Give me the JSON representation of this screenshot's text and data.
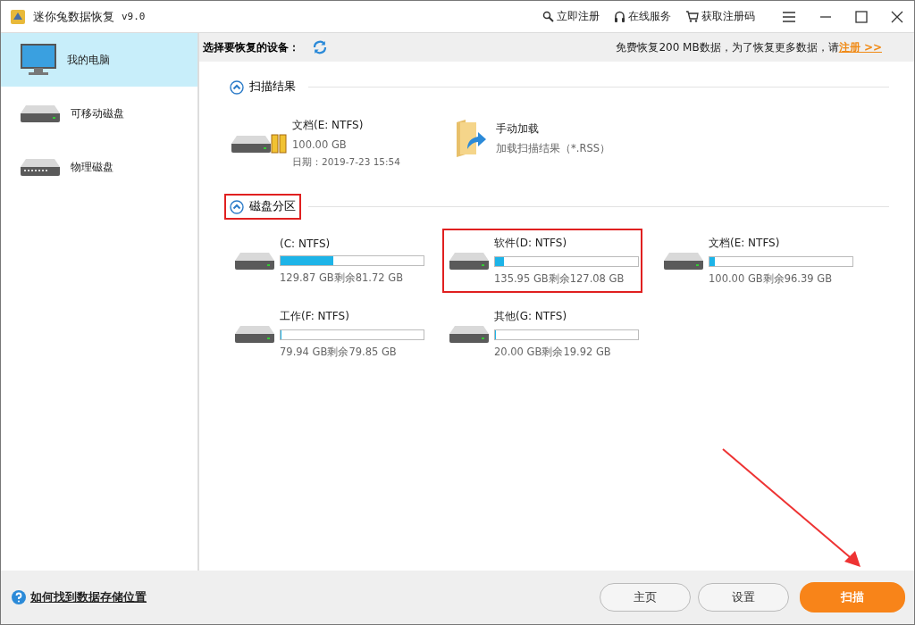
{
  "window": {
    "title": "迷你兔数据恢复",
    "version": "v9.0"
  },
  "title_links": [
    {
      "kind": "register",
      "label": "立即注册"
    },
    {
      "kind": "service",
      "label": "在线服务"
    },
    {
      "kind": "cart",
      "label": "获取注册码"
    }
  ],
  "sidebar": {
    "items": [
      {
        "kind": "computer",
        "label": "我的电脑",
        "selected": true
      },
      {
        "kind": "removable",
        "label": "可移动磁盘",
        "selected": false
      },
      {
        "kind": "physical",
        "label": "物理磁盘",
        "selected": false
      }
    ]
  },
  "toolbar": {
    "label": "选择要恢复的设备：",
    "promo": "免费恢复200 MB数据，为了恢复更多数据，请",
    "promo_link": "注册 >>"
  },
  "scan_results": {
    "title": "扫描结果",
    "expanded": true,
    "highlighted": false,
    "result": {
      "name": "文档(E: NTFS)",
      "size": "100.00 GB",
      "date": "日期：2019-7-23 15:54"
    },
    "manual_load": {
      "title": "手动加载",
      "subtitle": "加载扫描结果（*.RSS）"
    }
  },
  "partitions": {
    "title": "磁盘分区",
    "expanded": true,
    "highlighted": true,
    "items": [
      {
        "name": "(C: NTFS)",
        "level": 0.37,
        "info": "129.87 GB剩余81.72 GB",
        "highlighted": false
      },
      {
        "name": "软件(D: NTFS)",
        "level": 0.065,
        "info": "135.95 GB剩余127.08 GB",
        "highlighted": true
      },
      {
        "name": "文档(E: NTFS)",
        "level": 0.036,
        "info": "100.00 GB剩余96.39 GB",
        "highlighted": false
      },
      {
        "name": "工作(F: NTFS)",
        "level": 0.002,
        "info": "79.94 GB剩余79.85 GB",
        "highlighted": false
      },
      {
        "name": "其他(G: NTFS)",
        "level": 0.004,
        "info": "20.00 GB剩余19.92 GB",
        "highlighted": false
      }
    ]
  },
  "footer": {
    "help_link": "如何找到数据存储位置",
    "buttons": [
      {
        "kind": "secondary",
        "label": "主页"
      },
      {
        "kind": "secondary",
        "label": "设置"
      },
      {
        "kind": "primary",
        "label": "扫描"
      }
    ]
  }
}
